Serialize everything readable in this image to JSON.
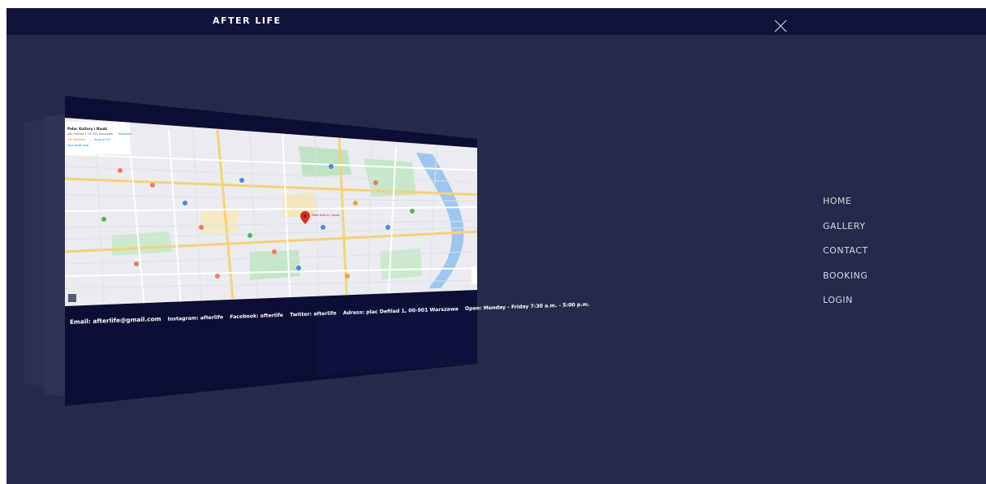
{
  "header": {
    "brand": "AFTER LIFE",
    "close_icon": "close-icon"
  },
  "menu": {
    "items": [
      {
        "label": "HOME"
      },
      {
        "label": "GALLERY"
      },
      {
        "label": "CONTACT"
      },
      {
        "label": "BOOKING"
      },
      {
        "label": "LOGIN"
      }
    ]
  },
  "contact": {
    "email": "Email: afterlife@gmail.com",
    "instagram": "Instagram: afterlife",
    "facebook": "Facebook: afterlife",
    "twitter": "Twitter: afterlife",
    "address": "Adress: plac Defilad 1, 00-901 Warszawa",
    "hours": "Open: Monday - Friday 7:30 a.m. - 5:00 p.m."
  },
  "map": {
    "place_title": "Pałac Kultury i Nauki",
    "place_address": "plac Defilad 1, 00-901 Warszawa",
    "rating": "4.6 ★★★★★",
    "reviews": "Views of 127",
    "larger_map": "View larger map",
    "directions": "Directions",
    "pin_label": "Pałac Kultury i Nauki"
  },
  "colors": {
    "background": "#262a4a",
    "topbar": "#10143a",
    "panel": "#0c0e35",
    "menu_text": "#d4d7e6"
  }
}
